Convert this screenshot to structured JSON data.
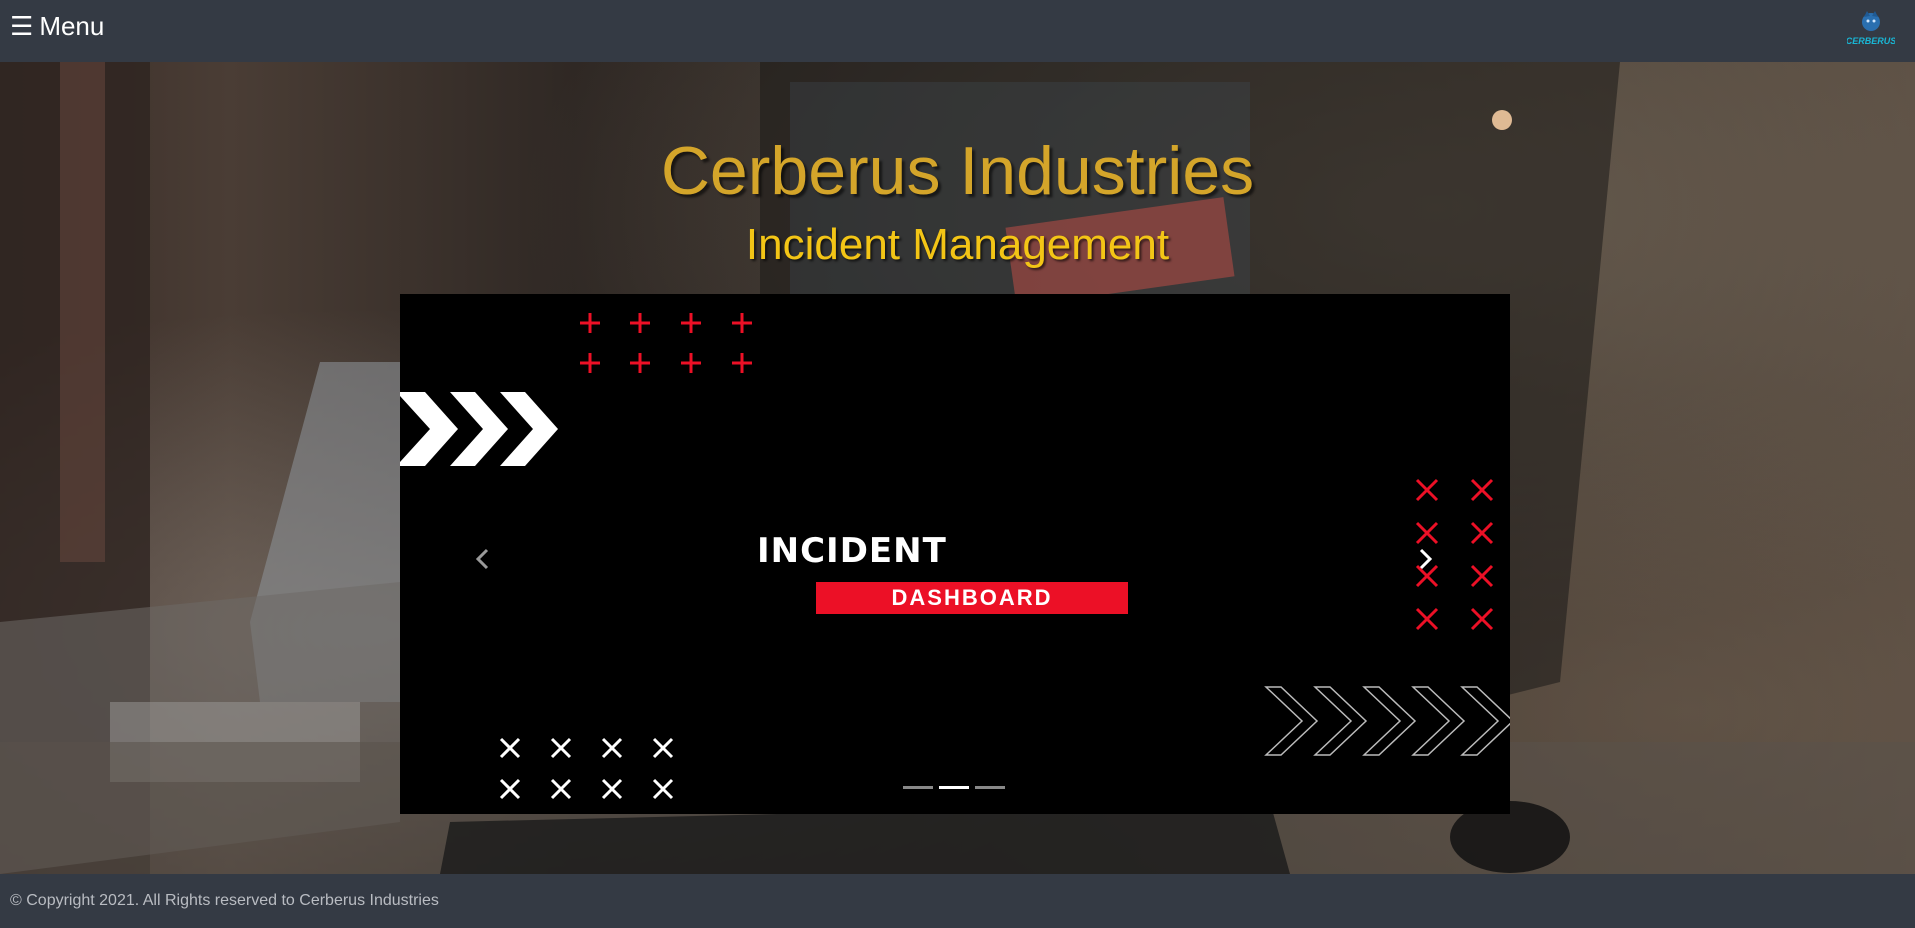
{
  "header": {
    "menu_icon": "hamburger-icon",
    "menu_label": "Menu",
    "logo_text": "CERBERUS"
  },
  "hero": {
    "title": "Cerberus Industries",
    "subtitle": "Incident Management"
  },
  "carousel": {
    "prev_icon": "chevron-left-icon",
    "next_icon": "chevron-right-icon",
    "slide": {
      "headline": "INCIDENT",
      "badge": "DASHBOARD"
    },
    "indicator_count": 3,
    "active_indicator": 2
  },
  "footer": {
    "copyright": "© Copyright 2021. All Rights reserved to Cerberus Industries"
  },
  "colors": {
    "topbar": "#343a44",
    "title": "#d4a52a",
    "subtitle": "#f3c516",
    "accent_red": "#ec1026"
  }
}
